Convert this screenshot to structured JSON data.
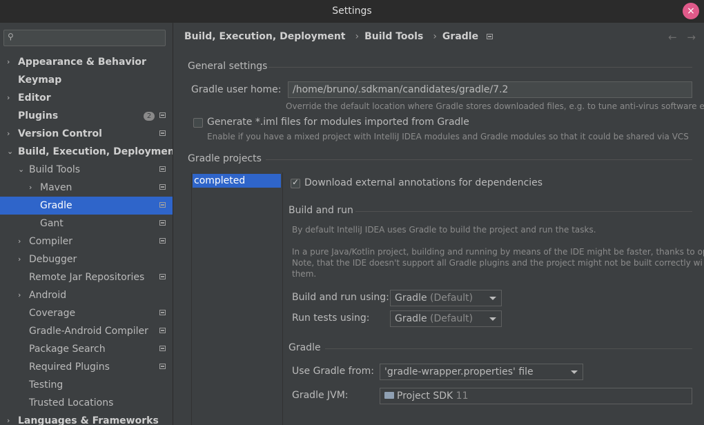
{
  "window": {
    "title": "Settings",
    "close": "×"
  },
  "sidebar": {
    "search": {
      "icon": "search-icon"
    },
    "items": [
      {
        "label": "Appearance & Behavior",
        "arrow": "›",
        "bold": true
      },
      {
        "label": "Keymap",
        "bold": true
      },
      {
        "label": "Editor",
        "arrow": "›",
        "bold": true
      },
      {
        "label": "Plugins",
        "bold": true,
        "badge": "2"
      },
      {
        "label": "Version Control",
        "arrow": "›",
        "bold": true
      },
      {
        "label": "Build, Execution, Deployment",
        "arrow": "⌄",
        "bold": true
      },
      {
        "label": "Build Tools",
        "arrow": "⌄"
      },
      {
        "label": "Maven",
        "arrow": "›"
      },
      {
        "label": "Gradle",
        "selected": true
      },
      {
        "label": "Gant"
      },
      {
        "label": "Compiler",
        "arrow": "›"
      },
      {
        "label": "Debugger",
        "arrow": "›"
      },
      {
        "label": "Remote Jar Repositories"
      },
      {
        "label": "Android",
        "arrow": "›"
      },
      {
        "label": "Coverage"
      },
      {
        "label": "Gradle-Android Compiler"
      },
      {
        "label": "Package Search"
      },
      {
        "label": "Required Plugins"
      },
      {
        "label": "Testing"
      },
      {
        "label": "Trusted Locations"
      },
      {
        "label": "Languages & Frameworks",
        "arrow": "›",
        "bold": true
      }
    ]
  },
  "breadcrumb": {
    "items": [
      "Build, Execution, Deployment",
      "Build Tools",
      "Gradle"
    ],
    "separator": "›",
    "back": "←",
    "forward": "→"
  },
  "general": {
    "title": "General settings",
    "user_home_label": "Gradle user home:",
    "user_home_value": "/home/bruno/.sdkman/candidates/gradle/7.2",
    "user_home_hint": "Override the default location where Gradle stores downloaded files, e.g. to tune anti-virus software e",
    "iml_label": "Generate *.iml files for modules imported from Gradle",
    "iml_hint": "Enable if you have a mixed project with IntelliJ IDEA modules and Gradle modules so that it could be shared via VCS",
    "iml_checked": false
  },
  "projects": {
    "title": "Gradle projects",
    "list": [
      "completed"
    ],
    "download_annotations_label": "Download external annotations for dependencies",
    "download_annotations_checked": true
  },
  "build_and_run": {
    "title": "Build and run",
    "hint1": "By default IntelliJ IDEA uses Gradle to build the project and run the tasks.",
    "hint2": "In a pure Java/Kotlin project, building and running by means of the IDE might be faster, thanks to op",
    "hint3": "Note, that the IDE doesn't support all Gradle plugins and the project might not be built correctly wi",
    "hint4": "them.",
    "build_run_label": "Build and run using:",
    "build_run_value": "Gradle",
    "build_run_suffix": "(Default)",
    "tests_label": "Run tests using:",
    "tests_value": "Gradle",
    "tests_suffix": "(Default)"
  },
  "gradle": {
    "title": "Gradle",
    "use_from_label": "Use Gradle from:",
    "use_from_value": "'gradle-wrapper.properties' file",
    "jvm_label": "Gradle JVM:",
    "jvm_value": "Project SDK",
    "jvm_version": "11"
  }
}
